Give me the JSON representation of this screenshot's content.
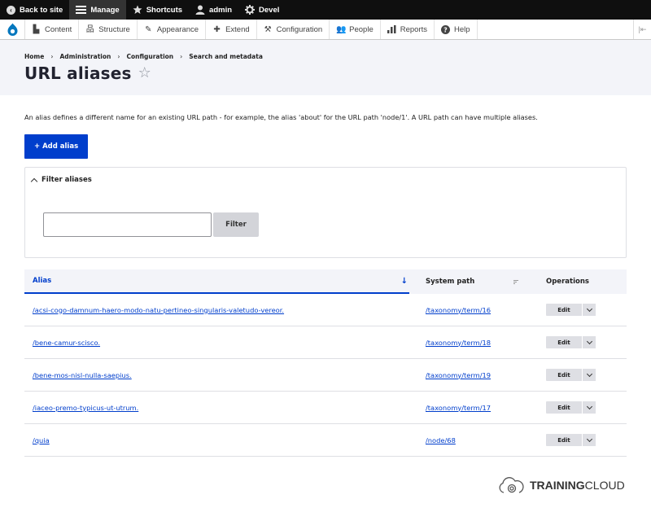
{
  "toolbar": {
    "back_label": "Back to site",
    "manage_label": "Manage",
    "shortcuts_label": "Shortcuts",
    "user_label": "admin",
    "devel_label": "Devel"
  },
  "tray": {
    "items": [
      {
        "label": "Content",
        "icon": "file-icon"
      },
      {
        "label": "Structure",
        "icon": "structure-icon"
      },
      {
        "label": "Appearance",
        "icon": "brush-icon"
      },
      {
        "label": "Extend",
        "icon": "puzzle-icon"
      },
      {
        "label": "Configuration",
        "icon": "wrench-icon"
      },
      {
        "label": "People",
        "icon": "people-icon"
      },
      {
        "label": "Reports",
        "icon": "bar-chart-icon"
      },
      {
        "label": "Help",
        "icon": "help-icon"
      }
    ]
  },
  "breadcrumb": [
    "Home",
    "Administration",
    "Configuration",
    "Search and metadata"
  ],
  "page": {
    "title": "URL aliases",
    "description": "An alias defines a different name for an existing URL path - for example, the alias 'about' for the URL path 'node/1'. A URL path can have multiple aliases.",
    "add_button": "+ Add alias"
  },
  "filter": {
    "summary": "Filter aliases",
    "input_value": "",
    "button": "Filter"
  },
  "table": {
    "headers": {
      "alias": "Alias",
      "system_path": "System path",
      "operations": "Operations"
    },
    "rows": [
      {
        "alias": "/acsi-cogo-damnum-haero-modo-natu-pertineo-singularis-valetudo-vereor.",
        "system_path": "/taxonomy/term/16",
        "op": "Edit"
      },
      {
        "alias": "/bene-camur-scisco.",
        "system_path": "/taxonomy/term/18",
        "op": "Edit"
      },
      {
        "alias": "/bene-mos-nisl-nulla-saepius.",
        "system_path": "/taxonomy/term/19",
        "op": "Edit"
      },
      {
        "alias": "/iaceo-premo-typicus-ut-utrum.",
        "system_path": "/taxonomy/term/17",
        "op": "Edit"
      },
      {
        "alias": "/quia",
        "system_path": "/node/68",
        "op": "Edit"
      }
    ]
  },
  "brand": {
    "bold": "TRAINING",
    "rest": "CLOUD"
  },
  "colors": {
    "accent": "#003ecc",
    "toolbar": "#0f0f0f",
    "header_bg": "#f3f4f9"
  }
}
